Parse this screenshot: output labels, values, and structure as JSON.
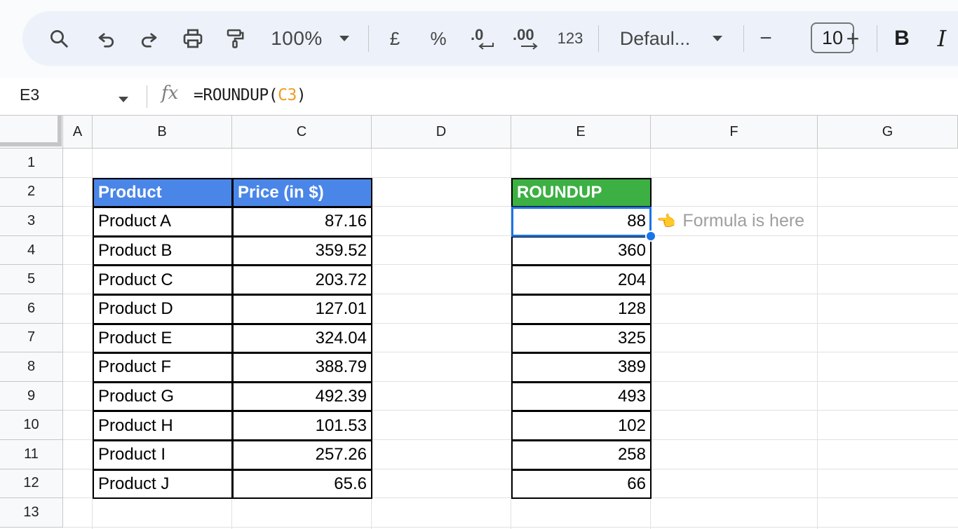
{
  "toolbar": {
    "zoom": "100%",
    "currency_symbol": "£",
    "percent_symbol": "%",
    "decrease_decimal": ".0",
    "increase_decimal": ".00",
    "more_formats": "123",
    "font_family": "Defaul...",
    "font_size": "10",
    "minus": "−",
    "plus": "+",
    "bold": "B",
    "italic": "I"
  },
  "formula_bar": {
    "name_box": "E3",
    "fx": "fx",
    "formula_prefix": "=ROUNDUP(",
    "formula_ref": "C3",
    "formula_suffix": ")"
  },
  "columns": [
    "A",
    "B",
    "C",
    "D",
    "E",
    "F",
    "G"
  ],
  "rows": [
    "1",
    "2",
    "3",
    "4",
    "5",
    "6",
    "7",
    "8",
    "9",
    "10",
    "11",
    "12",
    "13"
  ],
  "table": {
    "header_product": "Product",
    "header_price": "Price (in $)",
    "header_roundup": "ROUNDUP",
    "products": [
      "Product A",
      "Product B",
      "Product C",
      "Product D",
      "Product E",
      "Product F",
      "Product G",
      "Product H",
      "Product I",
      "Product J"
    ],
    "prices": [
      "87.16",
      "359.52",
      "203.72",
      "127.01",
      "324.04",
      "388.79",
      "492.39",
      "101.53",
      "257.26",
      "65.6"
    ],
    "roundup": [
      "88",
      "360",
      "204",
      "128",
      "325",
      "389",
      "493",
      "102",
      "258",
      "66"
    ]
  },
  "note": {
    "emoji": "👈",
    "text": "Formula is here"
  },
  "colors": {
    "header_blue": "#4a86e8",
    "header_green": "#3cb043",
    "selection": "#1a73e8",
    "formula_ref": "#f29c1f"
  }
}
